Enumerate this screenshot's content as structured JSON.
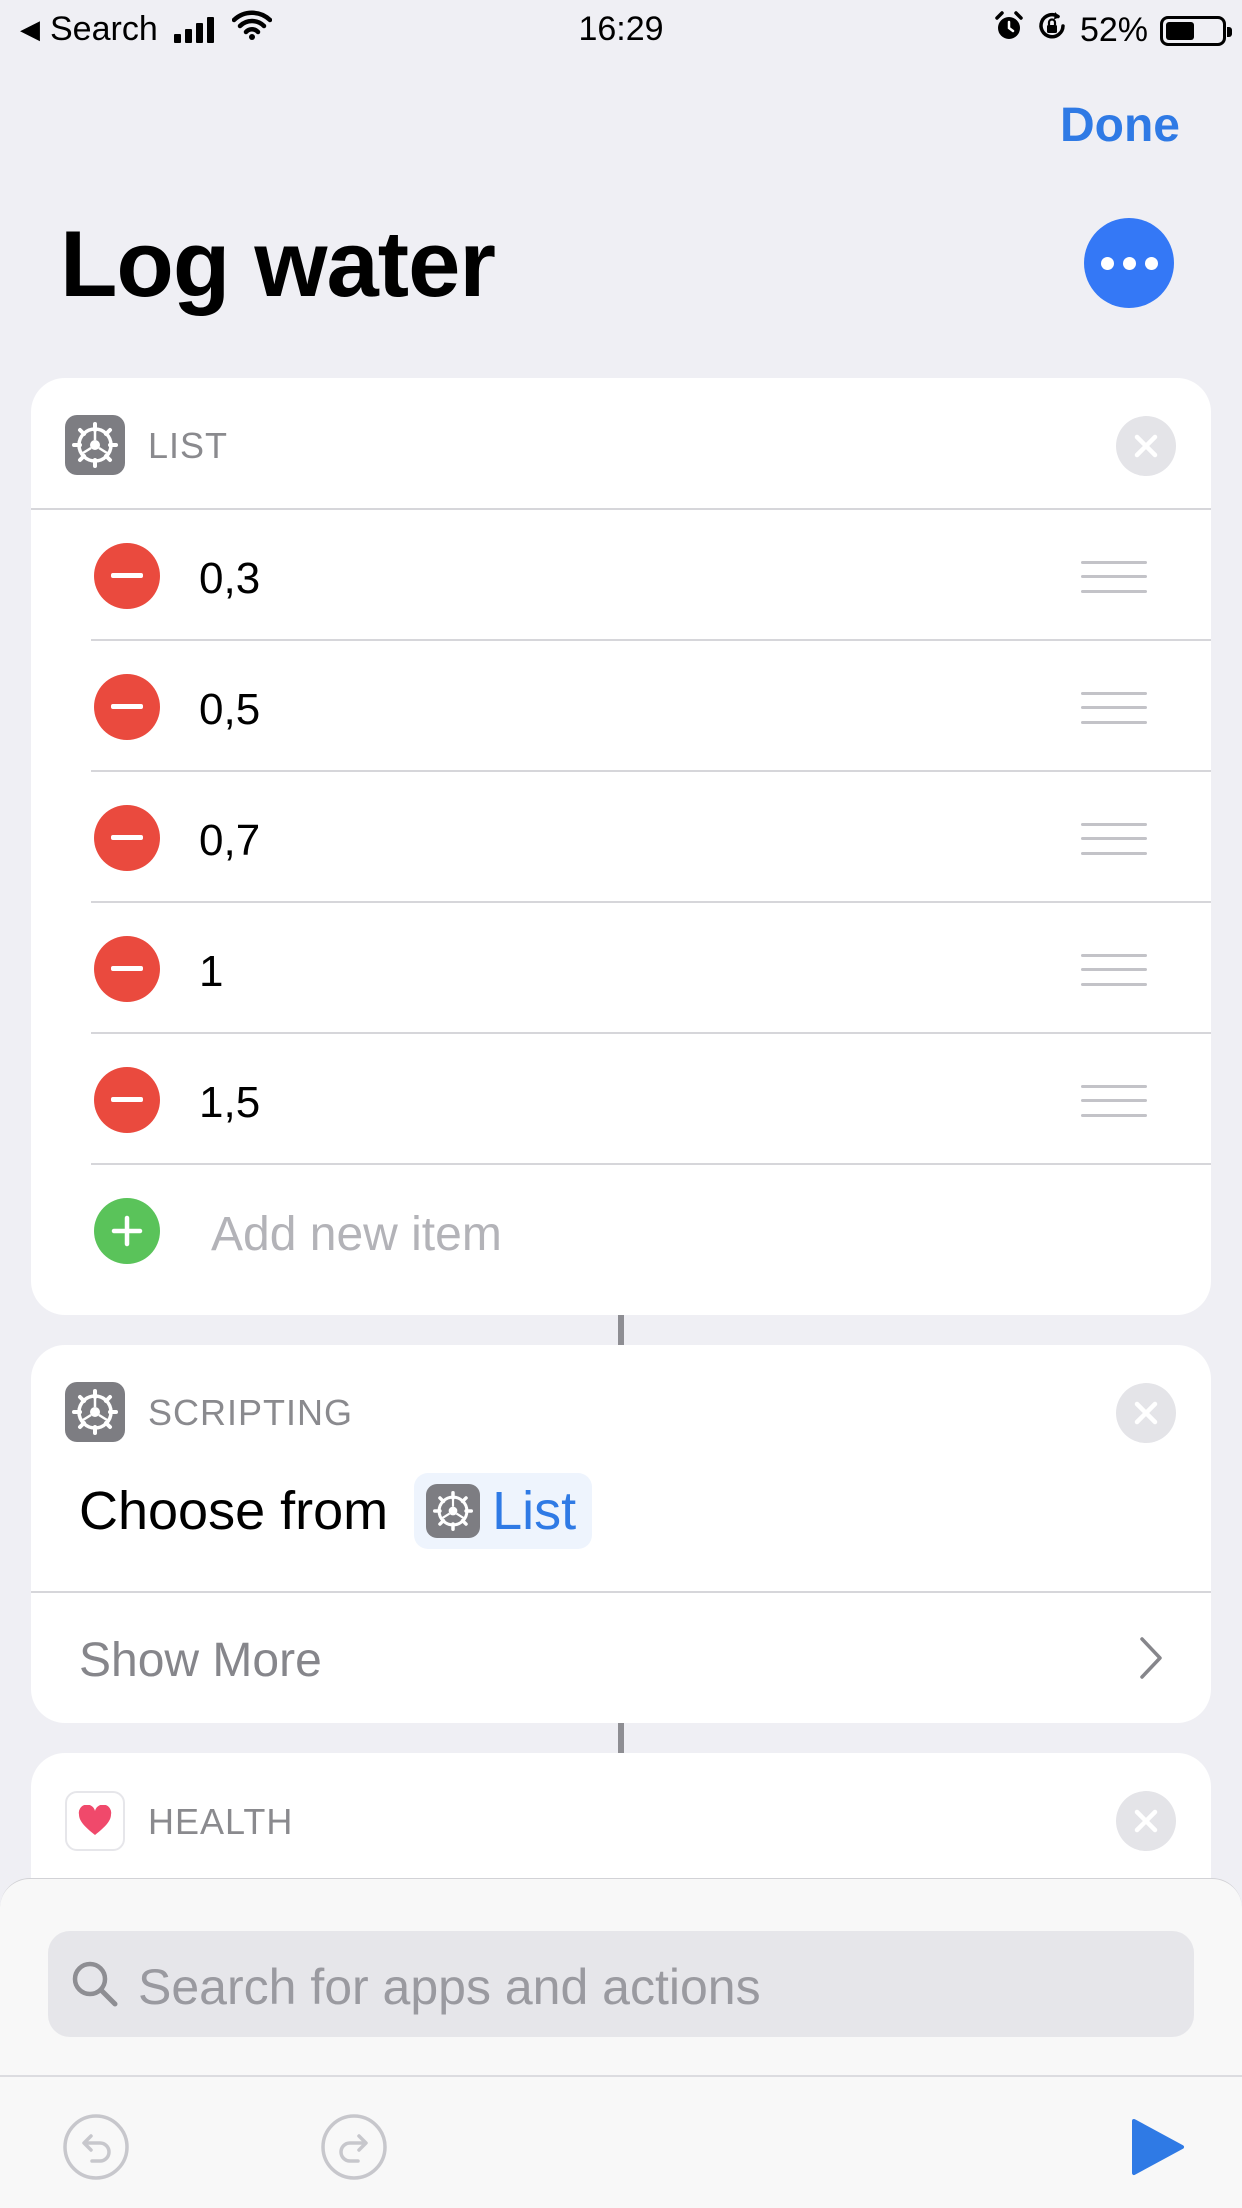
{
  "status_bar": {
    "back_label": "Search",
    "time": "16:29",
    "battery": "52%",
    "battery_level": 0.52,
    "icons": [
      "back-arrow-icon",
      "signal-icon",
      "wifi-icon",
      "alarm-icon",
      "rotation-lock-icon",
      "battery-icon"
    ]
  },
  "nav": {
    "done_label": "Done"
  },
  "shortcut": {
    "title": "Log water"
  },
  "list_action": {
    "category": "LIST",
    "items": [
      "0,3",
      "0,5",
      "0,7",
      "1",
      "1,5"
    ],
    "add_placeholder": "Add new item"
  },
  "choose_action": {
    "category": "SCRIPTING",
    "label": "Choose from",
    "variable": "List",
    "show_more": "Show More"
  },
  "health_action": {
    "category": "HEALTH"
  },
  "search": {
    "placeholder": "Search for apps and actions"
  },
  "colors": {
    "accent": "#2f7ae5",
    "more_button": "#3478f6",
    "delete_red": "#ea4a3e",
    "add_green": "#5ac35a",
    "background": "#efeff4"
  }
}
